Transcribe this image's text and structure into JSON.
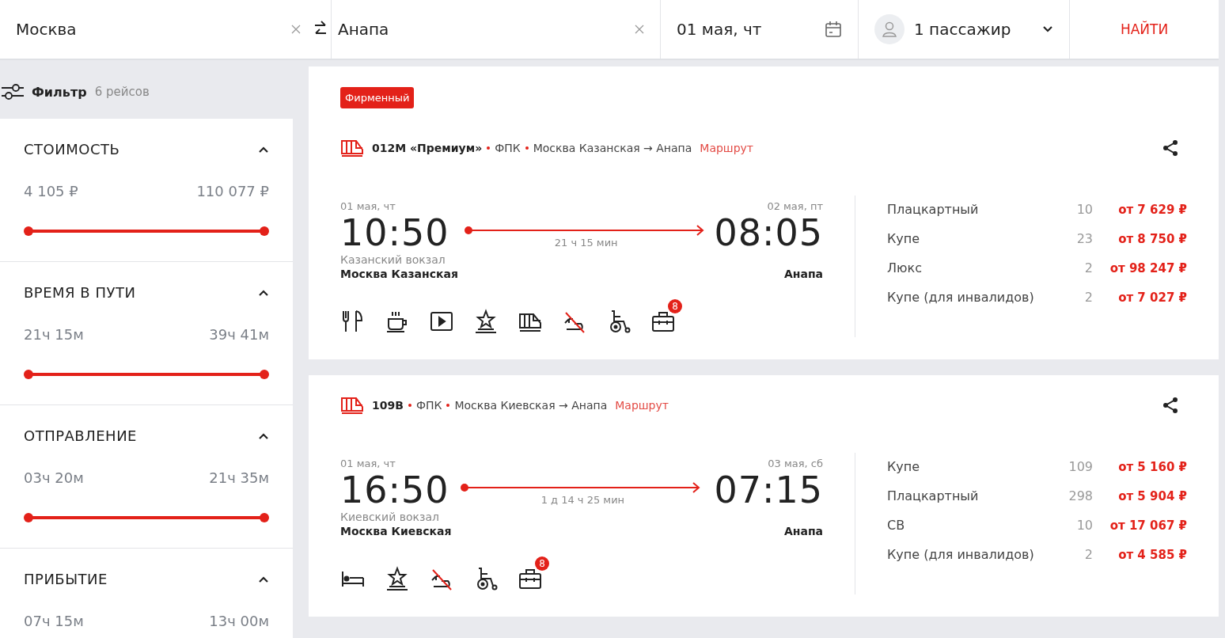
{
  "search": {
    "from": "Москва",
    "to": "Анапа",
    "date": "01 мая, чт",
    "passengers": "1 пассажир",
    "submit": "НАЙТИ"
  },
  "filter": {
    "title": "Фильтр",
    "count": "6 рейсов",
    "sections": [
      {
        "title": "СТОИМОСТЬ",
        "expanded": true,
        "min": "4 105 ₽",
        "max": "110 077 ₽",
        "level": 1
      },
      {
        "title": "ВРЕМЯ В ПУТИ",
        "expanded": true,
        "min": "21ч 15м",
        "max": "39ч 41м",
        "level": 1
      },
      {
        "title": "ОТПРАВЛЕНИЕ",
        "expanded": true,
        "min": "03ч 20м",
        "max": "21ч 35м",
        "level": 1
      },
      {
        "title": "ПРИБЫТИЕ",
        "expanded": true,
        "min": "07ч 15м",
        "max": "13ч 00м"
      }
    ]
  },
  "trains": [
    {
      "badge": "Фирменный",
      "number": "012М «Премиум»",
      "carrier": "ФПК",
      "route": "Москва Казанская → Анапа",
      "route_link": "Маршрут",
      "dep_date": "01 мая, чт",
      "dep_time": "10:50",
      "dep_station": "Казанский вокзал",
      "dep_city": "Москва Казанская",
      "duration": "21 ч 15 мин",
      "arr_date": "02 мая, пт",
      "arr_time": "08:05",
      "arr_city": "Анапа",
      "amenities": [
        {
          "kind": "dining"
        },
        {
          "kind": "coffee"
        },
        {
          "kind": "video"
        },
        {
          "kind": "star"
        },
        {
          "kind": "train"
        },
        {
          "kind": "no-pets"
        },
        {
          "kind": "wheelchair"
        },
        {
          "kind": "luggage",
          "badge": "8"
        }
      ],
      "classes": [
        {
          "name": "Плацкартный",
          "seats": "10",
          "price": "от 7 629 ₽"
        },
        {
          "name": "Купе",
          "seats": "23",
          "price": "от 8 750 ₽"
        },
        {
          "name": "Люкс",
          "seats": "2",
          "price": "от 98 247 ₽"
        },
        {
          "name": "Купе (для инвалидов)",
          "seats": "2",
          "price": "от 7 027 ₽"
        }
      ]
    },
    {
      "number": "109В",
      "carrier": "ФПК",
      "route": "Москва Киевская → Анапа",
      "route_link": "Маршрут",
      "dep_date": "01 мая, чт",
      "dep_time": "16:50",
      "dep_station": "Киевский вокзал",
      "dep_city": "Москва Киевская",
      "duration": "1 д 14 ч 25 мин",
      "arr_date": "03 мая, сб",
      "arr_time": "07:15",
      "arr_city": "Анапа",
      "amenities": [
        {
          "kind": "bed"
        },
        {
          "kind": "star"
        },
        {
          "kind": "no-pets"
        },
        {
          "kind": "wheelchair"
        },
        {
          "kind": "luggage",
          "badge": "8"
        }
      ],
      "classes": [
        {
          "name": "Купе",
          "seats": "109",
          "price": "от 5 160 ₽"
        },
        {
          "name": "Плацкартный",
          "seats": "298",
          "price": "от 5 904 ₽"
        },
        {
          "name": "СВ",
          "seats": "10",
          "price": "от 17 067 ₽"
        },
        {
          "name": "Купе (для инвалидов)",
          "seats": "2",
          "price": "от 4 585 ₽"
        }
      ]
    }
  ]
}
